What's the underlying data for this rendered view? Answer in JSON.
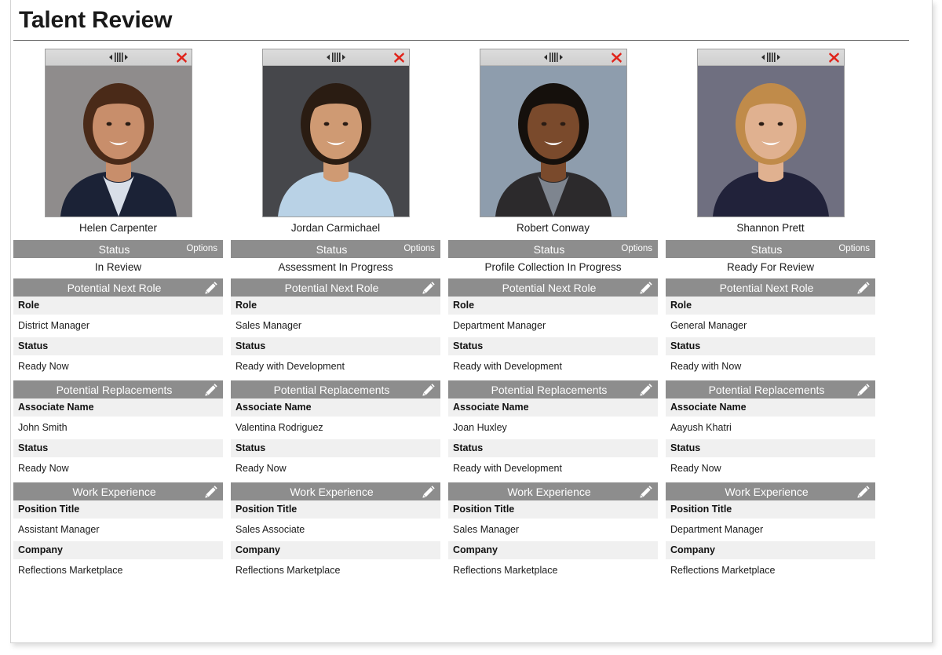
{
  "header": {
    "title": "Talent Review"
  },
  "icons": {
    "drag_handle": "drag-handle-icon",
    "close": "close-icon",
    "edit": "pencil-edit-icon"
  },
  "colors": {
    "section_header_bg": "#8d8d8d",
    "field_label_bg": "#f0f0f0",
    "close_red": "#e0231a",
    "titlebar_bg": "#d6d6d6",
    "page_bg": "#ffffff",
    "text": "#1a1a1a"
  },
  "labels": {
    "status_header": "Status",
    "options": "Options",
    "potential_next_role": "Potential Next Role",
    "potential_replacements": "Potential Replacements",
    "work_experience": "Work Experience",
    "role": "Role",
    "status": "Status",
    "associate_name": "Associate Name",
    "position_title": "Position Title",
    "company": "Company"
  },
  "people": [
    {
      "name": "Helen Carpenter",
      "photo": {
        "background": "#8f8c8c",
        "hair": "#4a2a18",
        "skin": "#c88e6b",
        "clothing": "#1b2236",
        "shirt": "#d8dee8"
      },
      "status_value": "In Review",
      "next_role": {
        "role": "District Manager",
        "status": "Ready Now"
      },
      "replacement": {
        "associate_name": "John Smith",
        "status": "Ready Now"
      },
      "work_experience": {
        "position_title": "Assistant Manager",
        "company": "Reflections Marketplace"
      }
    },
    {
      "name": "Jordan Carmichael",
      "photo": {
        "background": "#46474b",
        "hair": "#2a1c12",
        "skin": "#cf9a73",
        "clothing": "#b9d2e6",
        "shirt": "#b9d2e6"
      },
      "status_value": "Assessment In Progress",
      "next_role": {
        "role": "Sales Manager",
        "status": "Ready with Development"
      },
      "replacement": {
        "associate_name": "Valentina Rodriguez",
        "status": "Ready Now"
      },
      "work_experience": {
        "position_title": "Sales Associate",
        "company": "Reflections Marketplace"
      }
    },
    {
      "name": "Robert Conway",
      "photo": {
        "background": "#8e9dad",
        "hair": "#15100c",
        "skin": "#7a4a2c",
        "clothing": "#2c2a2c",
        "shirt": "#7e858f"
      },
      "status_value": "Profile Collection In Progress",
      "next_role": {
        "role": "Department Manager",
        "status": "Ready with Development"
      },
      "replacement": {
        "associate_name": "Joan Huxley",
        "status": "Ready with Development"
      },
      "work_experience": {
        "position_title": "Sales Manager",
        "company": "Reflections Marketplace"
      }
    },
    {
      "name": "Shannon Prett",
      "photo": {
        "background": "#6f6f80",
        "hair": "#c08b4a",
        "skin": "#e0b190",
        "clothing": "#21223a",
        "shirt": "#21223a"
      },
      "status_value": "Ready For Review",
      "next_role": {
        "role": "General Manager",
        "status": "Ready with Now"
      },
      "replacement": {
        "associate_name": "Aayush Khatri",
        "status": "Ready Now"
      },
      "work_experience": {
        "position_title": "Department Manager",
        "company": "Reflections Marketplace"
      }
    }
  ]
}
